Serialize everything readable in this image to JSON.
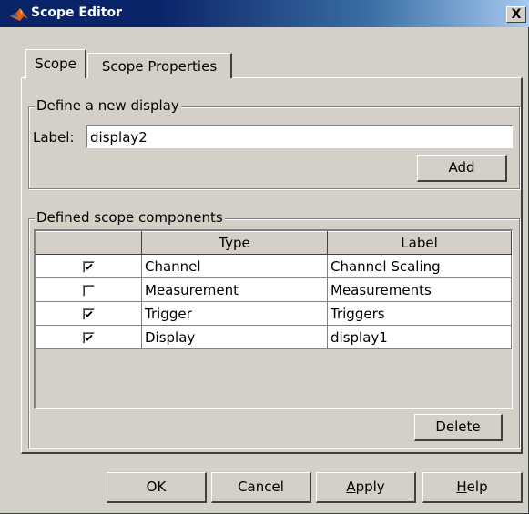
{
  "window": {
    "title": "Scope Editor",
    "close_label": "X"
  },
  "tabs": [
    {
      "label": "Scope",
      "selected": true
    },
    {
      "label": "Scope Properties",
      "selected": false
    }
  ],
  "define_display": {
    "group_label": "Define a new display",
    "label_caption": "Label:",
    "label_value": "display2",
    "add_button": "Add"
  },
  "components": {
    "group_label": "Defined scope components",
    "columns": [
      "",
      "Type",
      "Label"
    ],
    "rows": [
      {
        "checked": true,
        "type": "Channel",
        "label": "Channel Scaling"
      },
      {
        "checked": false,
        "type": "Measurement",
        "label": "Measurements"
      },
      {
        "checked": true,
        "type": "Trigger",
        "label": "Triggers"
      },
      {
        "checked": true,
        "type": "Display",
        "label": "display1"
      }
    ],
    "delete_button": "Delete"
  },
  "buttons": {
    "ok": "OK",
    "cancel": "Cancel",
    "apply_rest": "pply",
    "apply_mnemonic": "A",
    "help_rest": "elp",
    "help_mnemonic": "H"
  },
  "icons": {
    "app": "matlab-logo-icon",
    "check": "checkmark-icon"
  },
  "colors": {
    "face": "#d4d0c8",
    "title_start": "#0a246a",
    "title_end": "#a6caf0"
  }
}
